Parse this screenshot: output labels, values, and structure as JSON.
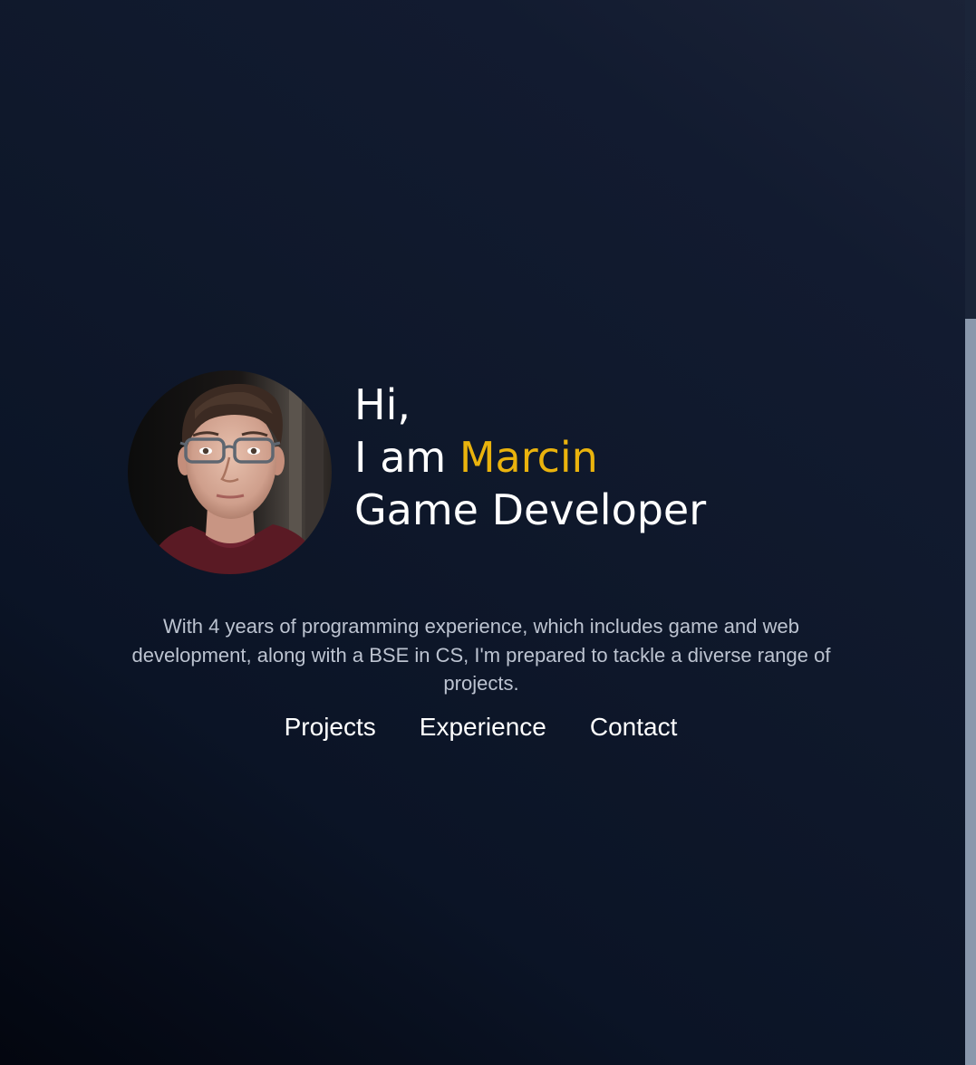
{
  "hero": {
    "greeting_line": "Hi,",
    "intro_prefix": "I am",
    "name": "Marcin",
    "role": "Game Developer"
  },
  "bio": {
    "text": "With 4 years of programming experience, which includes game and web development, along with a BSE in CS, I'm prepared to tackle a diverse range of projects."
  },
  "nav": {
    "items": [
      {
        "label": "Projects"
      },
      {
        "label": "Experience"
      },
      {
        "label": "Contact"
      }
    ]
  },
  "colors": {
    "accent": "#eab30d",
    "text": "#ffffff",
    "muted_text": "#bcc3d0",
    "background": "#0f182b"
  }
}
